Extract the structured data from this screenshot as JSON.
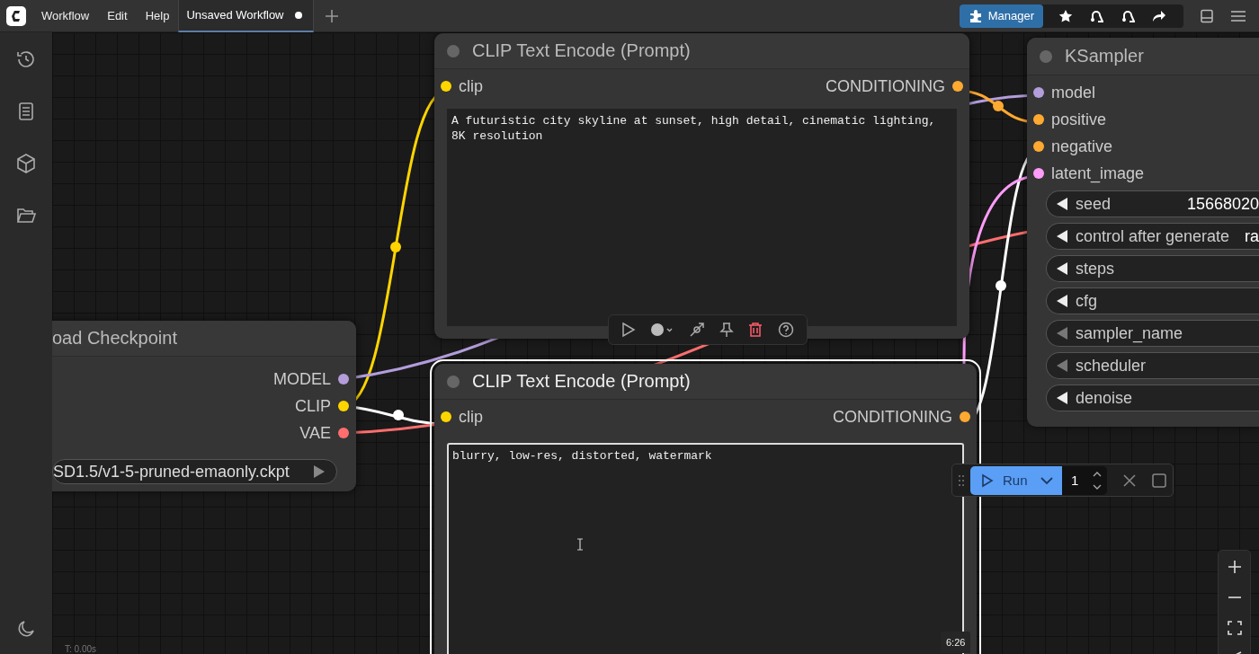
{
  "menu": [
    {
      "label": "Workflow"
    },
    {
      "label": "Edit"
    },
    {
      "label": "Help"
    }
  ],
  "tabs": [
    {
      "label": "Unsaved Workflow",
      "selected": true,
      "unsaved": true
    }
  ],
  "manager_button": "Manager",
  "nodes": [
    {
      "title": "CLIP Text Encode (Prompt)",
      "selected": false,
      "inputs": [
        {
          "name": "clip",
          "color": "#ffd500"
        }
      ],
      "outputs": [
        {
          "name": "CONDITIONING",
          "color": "#ffa931"
        }
      ],
      "widgets": [
        {
          "kind": "text",
          "value": "A futuristic city skyline at sunset, high detail, cinematic lighting, 8K resolution"
        }
      ]
    },
    {
      "title": "KSampler",
      "selected": false,
      "inputs": [
        {
          "name": "model",
          "color": "#b39ddb"
        },
        {
          "name": "positive",
          "color": "#ffa931"
        },
        {
          "name": "negative",
          "color": "#ffa931"
        },
        {
          "name": "latent_image",
          "color": "#ff9cf9"
        }
      ],
      "widgets": [
        {
          "kind": "number",
          "label": "seed",
          "value": "15668020",
          "arrow_dimmed": false
        },
        {
          "kind": "combo",
          "label": "control after generate",
          "value": "ra",
          "arrow_dimmed": false
        },
        {
          "kind": "number",
          "label": "steps",
          "arrow_dimmed": false
        },
        {
          "kind": "number",
          "label": "cfg",
          "arrow_dimmed": false
        },
        {
          "kind": "combo",
          "label": "sampler_name",
          "arrow_dimmed": true
        },
        {
          "kind": "combo",
          "label": "scheduler",
          "arrow_dimmed": true
        },
        {
          "kind": "number",
          "label": "denoise",
          "arrow_dimmed": false
        }
      ]
    },
    {
      "title": "oad Checkpoint",
      "selected": false,
      "outputs": [
        {
          "name": "MODEL",
          "color": "#b39ddb"
        },
        {
          "name": "CLIP",
          "color": "#ffd500"
        },
        {
          "name": "VAE",
          "color": "#ff6e6e"
        }
      ],
      "widgets": [
        {
          "kind": "file",
          "value": "SD1.5/v1-5-pruned-emaonly.ckpt"
        }
      ]
    },
    {
      "title": "CLIP Text Encode (Prompt)",
      "selected": true,
      "inputs": [
        {
          "name": "clip",
          "color": "#ffd500"
        }
      ],
      "outputs": [
        {
          "name": "CONDITIONING",
          "color": "#ffa931"
        }
      ],
      "widgets": [
        {
          "kind": "text",
          "value": "blurry, low-res, distorted, watermark"
        }
      ]
    }
  ],
  "run_bar": {
    "run_label": "Run",
    "batch_count": "1"
  },
  "timer": "T: 0.00s",
  "video_time": "6:26"
}
